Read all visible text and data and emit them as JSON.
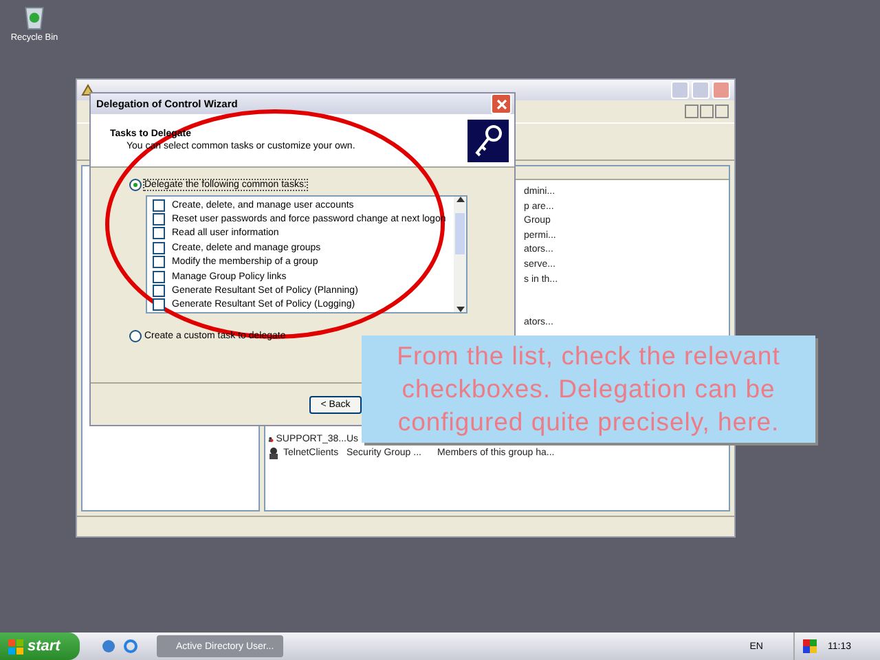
{
  "desktop": {
    "icons": [
      {
        "label": "Recycle Bin"
      }
    ]
  },
  "background_window": {
    "list_fragments": [
      {
        "kind": "text",
        "text": "dmini..."
      },
      {
        "kind": "text",
        "text": "p are..."
      },
      {
        "kind": "text",
        "text": "Group"
      },
      {
        "kind": "text",
        "text": "permi..."
      },
      {
        "kind": "text",
        "text": "ators..."
      },
      {
        "kind": "text",
        "text": "serve..."
      },
      {
        "kind": "text",
        "text": "s in th..."
      },
      {
        "kind": "blank"
      },
      {
        "kind": "blank"
      },
      {
        "kind": "text",
        "text": "ators..."
      }
    ],
    "rows": [
      {
        "name": "SUPPORT_38...",
        "type": "Us",
        "kind": "error"
      },
      {
        "name": "TelnetClients",
        "type": "Security Group ...",
        "description": "Members of this group ha...",
        "kind": "group"
      }
    ]
  },
  "dialog": {
    "title": "Delegation of Control Wizard",
    "heading": "Tasks to Delegate",
    "subheading": "You can select common tasks or customize your own.",
    "options": [
      {
        "label": "Delegate the following common tasks:",
        "selected": true
      },
      {
        "label": "Create a custom task to delegate",
        "selected": false
      }
    ],
    "tasks": [
      {
        "label": "Create, delete, and manage user accounts",
        "checked": false
      },
      {
        "label": "Reset user passwords and force password change at next logon",
        "checked": false
      },
      {
        "label": "Read all user information",
        "checked": false
      },
      {
        "label": "Create, delete and manage groups",
        "checked": false
      },
      {
        "label": "Modify the membership of a group",
        "checked": false
      },
      {
        "label": "Manage Group Policy links",
        "checked": false
      },
      {
        "label": "Generate Resultant Set of Policy (Planning)",
        "checked": false
      },
      {
        "label": "Generate Resultant Set of Policy (Logging)",
        "checked": false
      }
    ],
    "buttons": [
      "< Back"
    ]
  },
  "callout": {
    "text": "From the list, check the relevant checkboxes. Delegation can be configured quite precisely, here."
  },
  "taskbar": {
    "start": "start",
    "tasks": [
      {
        "label": "Active Directory User...",
        "selected": false
      }
    ],
    "language": "EN",
    "clock": "11:13"
  }
}
